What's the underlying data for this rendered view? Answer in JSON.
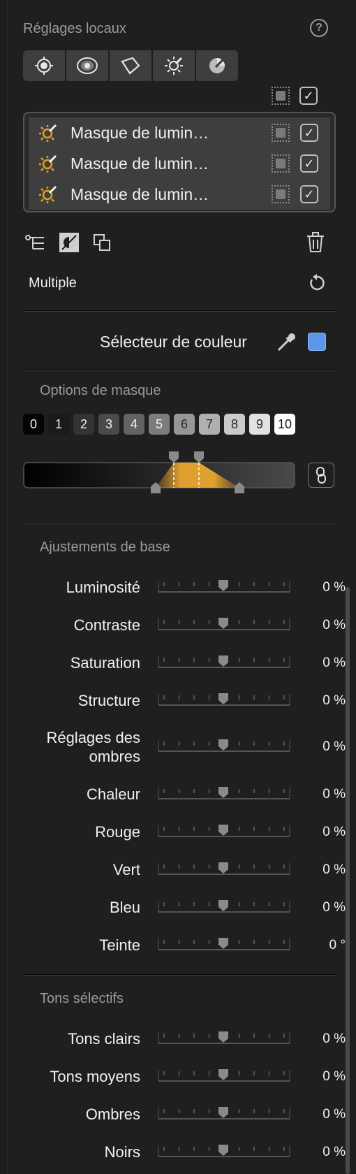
{
  "local_adjustments": {
    "title": "Réglages locaux",
    "tools": [
      "control-point-icon",
      "radial-filter-icon",
      "polygon-lasso-icon",
      "brightness-mask-icon",
      "color-mask-icon"
    ],
    "layers": [
      {
        "name": "Masque de lumin…",
        "checked": true
      },
      {
        "name": "Masque de lumin…",
        "checked": true
      },
      {
        "name": "Masque de lumin…",
        "checked": true
      }
    ],
    "selection_value": "Multiple"
  },
  "color_picker": {
    "label": "Sélecteur de couleur",
    "swatch": "#5b97e8"
  },
  "mask_options": {
    "title": "Options de masque",
    "levels": [
      "0",
      "1",
      "2",
      "3",
      "4",
      "5",
      "6",
      "7",
      "8",
      "9",
      "10"
    ]
  },
  "basic_adjustments": {
    "title": "Ajustements de base",
    "rows": [
      {
        "label": "Luminosité",
        "value": "0 %"
      },
      {
        "label": "Contraste",
        "value": "0 %"
      },
      {
        "label": "Saturation",
        "value": "0 %"
      },
      {
        "label": "Structure",
        "value": "0 %"
      },
      {
        "label": "Réglages des ombres",
        "value": "0 %"
      },
      {
        "label": "Chaleur",
        "value": "0 %"
      },
      {
        "label": "Rouge",
        "value": "0 %"
      },
      {
        "label": "Vert",
        "value": "0 %"
      },
      {
        "label": "Bleu",
        "value": "0 %"
      },
      {
        "label": "Teinte",
        "value": "0 °"
      }
    ]
  },
  "selective_tones": {
    "title": "Tons sélectifs",
    "rows": [
      {
        "label": "Tons clairs",
        "value": "0 %"
      },
      {
        "label": "Tons moyens",
        "value": "0 %"
      },
      {
        "label": "Ombres",
        "value": "0 %"
      },
      {
        "label": "Noirs",
        "value": "0 %"
      }
    ]
  }
}
